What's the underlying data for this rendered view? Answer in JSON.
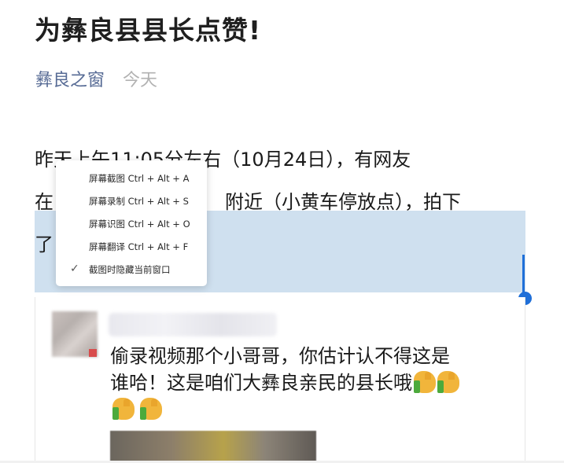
{
  "article": {
    "title": "为彝良县县长点赞!",
    "account": "彝良之窗",
    "date": "今天",
    "line1": "昨天上午11:05分左右（10月24日），有网友",
    "line2_start": "在",
    "line2_end": "附近（小黄车停放点），拍下",
    "line3_start": "了"
  },
  "context_menu": {
    "items": [
      "屏幕截图 Ctrl + Alt + A",
      "屏幕录制 Ctrl + Alt + S",
      "屏幕识图 Ctrl + Alt + O",
      "屏幕翻译 Ctrl + Alt + F",
      "截图时隐藏当前窗口"
    ],
    "check_icon": "✓"
  },
  "comment": {
    "text_line1": "偷录视频那个小哥哥，你估计认不得这是",
    "text_line2": "谁哈！这是咱们大彝良亲民的县长哦"
  },
  "colors": {
    "account": "#576b95",
    "date": "#b2b2b2",
    "selection": "#cfe0ef",
    "selection_handle": "#1f6fd8"
  }
}
